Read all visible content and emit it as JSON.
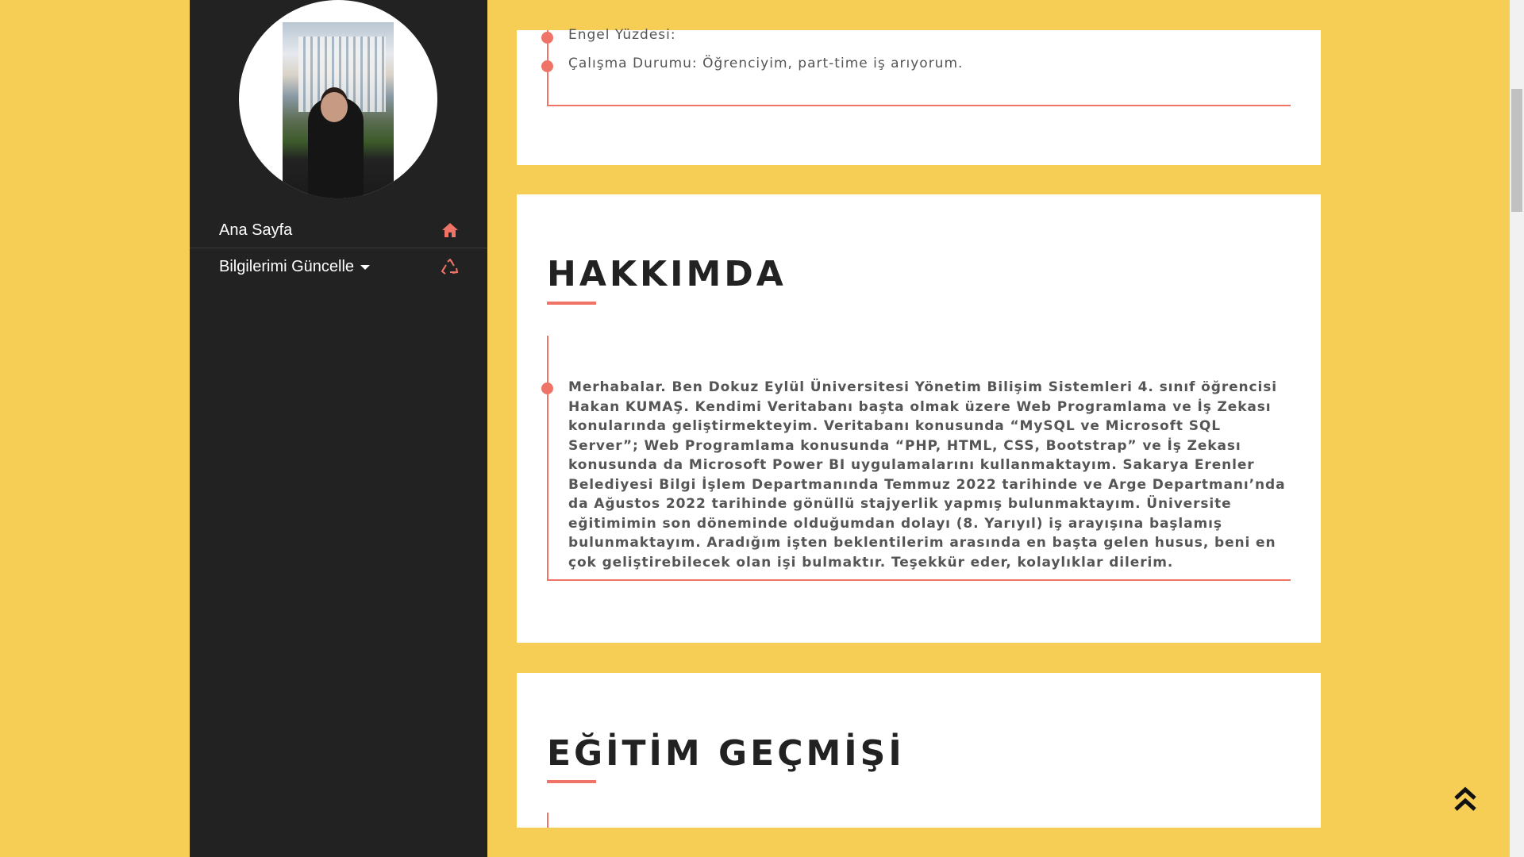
{
  "sidebar": {
    "profile_photo_alt": "profile-photo",
    "nav": [
      {
        "label": "Ana Sayfa",
        "icon": "home-icon"
      },
      {
        "label": "Bilgilerimi Güncelle",
        "icon": "recycle-icon",
        "has_dropdown": true
      }
    ]
  },
  "personal_info": {
    "items": [
      "Engel Yüzdesi:",
      "Çalışma Durumu: Öğrenciyim, part-time iş arıyorum."
    ]
  },
  "about": {
    "title": "HAKKIMDA",
    "text": "Merhabalar. Ben Dokuz Eylül Üniversitesi Yönetim Bilişim Sistemleri 4. sınıf öğrencisi Hakan KUMAŞ. Kendimi Veritabanı başta olmak üzere Web Programlama ve İş Zekası konularında geliştirmekteyim. Veritabanı konusunda “MySQL ve Microsoft SQL Server”; Web Programlama konusunda “PHP, HTML, CSS, Bootstrap” ve İş Zekası konusunda da Microsoft Power BI uygulamalarını kullanmaktayım. Sakarya Erenler Belediyesi Bilgi İşlem Departmanında Temmuz 2022 tarihinde ve Arge Departmanı’nda da Ağustos 2022 tarihinde gönüllü stajyerlik yapmış bulunmaktayım. Üniversite eğitimimin son döneminde olduğumdan dolayı (8. Yarıyıl) iş arayışına başlamış bulunmaktayım. Aradığım işten beklentilerim arasında en başta gelen husus, beni en çok geliştirebilecek olan işi bulmaktır. Teşekkür eder, kolaylıklar dilerim."
  },
  "education": {
    "title": "EĞİTİM GEÇMİŞİ"
  },
  "colors": {
    "background": "#f6ce55",
    "sidebar": "#222222",
    "accent": "#f07367",
    "card": "#ffffff"
  },
  "back_to_top_icon": "double-chevron-up-icon"
}
